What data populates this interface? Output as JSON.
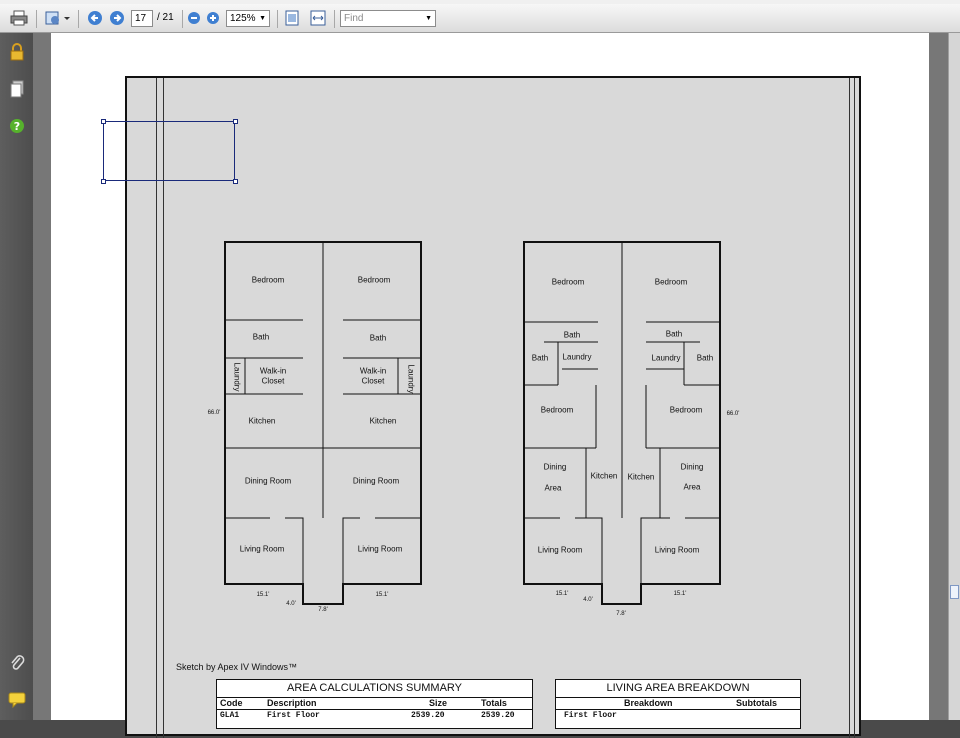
{
  "toolbar": {
    "page_current": "17",
    "page_total": "/ 21",
    "zoom": "125%",
    "find_placeholder": "Find"
  },
  "floorplan_left": {
    "rooms": [
      "Bedroom",
      "Bedroom",
      "Bath",
      "Bath",
      "Walk-in",
      "Closet",
      "Walk-in",
      "Closet",
      "Laundry",
      "Laundry",
      "Kitchen",
      "Kitchen",
      "Dining Room",
      "Dining Room",
      "Living Room",
      "Living Room"
    ],
    "dims": {
      "height": "66.0'",
      "left_width": "15.1'",
      "porch": "4.0'",
      "porch_depth": "7.8'",
      "right_width": "15.1'"
    }
  },
  "floorplan_right": {
    "rooms": [
      "Bedroom",
      "Bedroom",
      "Bath",
      "Bath",
      "Bath",
      "Bath",
      "Laundry",
      "Laundry",
      "Bedroom",
      "Bedroom",
      "Dining",
      "Area",
      "Kitchen",
      "Kitchen",
      "Dining",
      "Area",
      "Living Room",
      "Living Room"
    ],
    "dims": {
      "height": "66.0'",
      "left_width": "15.1'",
      "porch": "4.0'",
      "porch_depth": "7.8'",
      "right_width": "15.1'"
    }
  },
  "sketch_note": "Sketch by Apex IV Windows™",
  "area_calc": {
    "title": "AREA CALCULATIONS SUMMARY",
    "headers": [
      "Code",
      "Description",
      "Size",
      "Totals"
    ],
    "row": [
      "GLA1",
      "First Floor",
      "2539.20",
      "2539.20"
    ]
  },
  "living_area": {
    "title": "LIVING AREA BREAKDOWN",
    "headers": [
      "Breakdown",
      "Subtotals"
    ],
    "row": [
      "First Floor"
    ]
  }
}
